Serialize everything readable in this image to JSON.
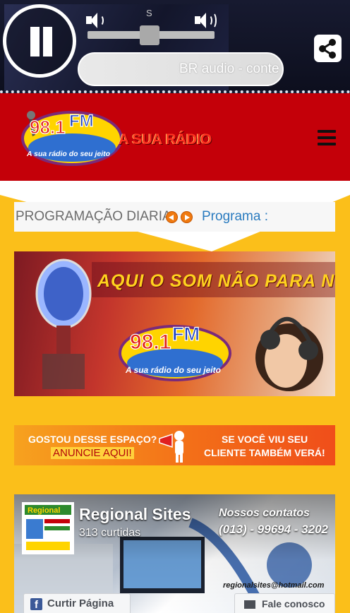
{
  "player": {
    "volume_mark": "S",
    "volume_level_fraction": 0.5,
    "now_playing": "BR audio - conte",
    "icons": [
      "pause-icon",
      "volume-low-icon",
      "volume-high-icon",
      "share-icon"
    ]
  },
  "header": {
    "logo_freq": "98.1",
    "logo_fm": "FM",
    "logo_tagline": "A sua rádio do seu jeito",
    "slogan": "A SUA RÁDIO",
    "menu_icon": "hamburger-menu-icon"
  },
  "schedule": {
    "title": "PROGRAMAÇÃO DIARIA",
    "program_label": "Programa :"
  },
  "banner": {
    "headline": "AQUI O SOM NÃO PARA NUNCA",
    "logo_freq": "98.1",
    "logo_fm": "FM",
    "logo_tagline": "A sua rádio do seu jeito"
  },
  "ad": {
    "left_line1": "GOSTOU DESSE ESPAÇO?",
    "left_line2": "ANUNCIE AQUI!",
    "right_line1": "SE VOCÊ VIU SEU",
    "right_line2": "CLIENTE TAMBÉM VERÁ!"
  },
  "facebook": {
    "page_name": "Regional Sites",
    "likes": "313 curtidas",
    "contacts_title": "Nossos contatos",
    "phone": "(013) - 99694 - 3202",
    "email": "regionalsites@hotmail.com",
    "like_button": "Curtir Página",
    "contact_button": "Fale conosco",
    "logo_word": "Regional"
  },
  "colors": {
    "header_red": "#c40009",
    "background_yellow": "#fbbf1a",
    "link_blue": "#2a7bbf",
    "facebook_blue": "#3b5998"
  }
}
